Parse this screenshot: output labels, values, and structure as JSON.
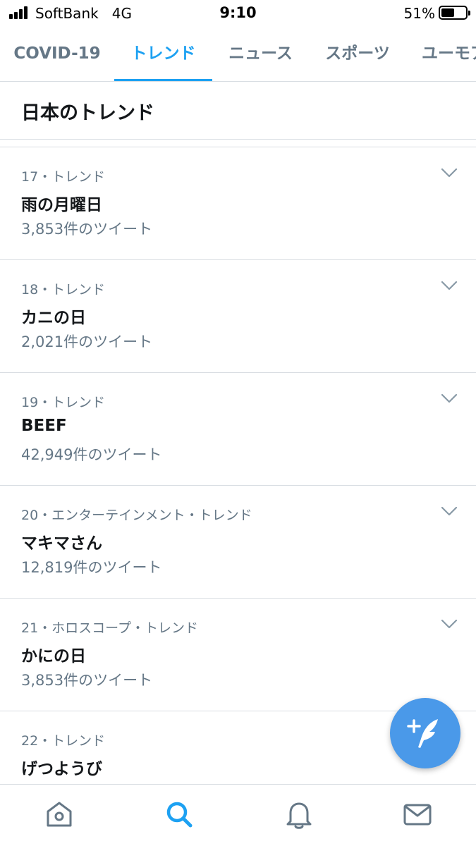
{
  "status_bar": {
    "carrier": "SoftBank",
    "network": "4G",
    "time": "9:10",
    "battery_percent": "51%"
  },
  "tabs": [
    {
      "label": "COVID-19",
      "active": false
    },
    {
      "label": "トレンド",
      "active": true
    },
    {
      "label": "ニュース",
      "active": false
    },
    {
      "label": "スポーツ",
      "active": false
    },
    {
      "label": "ユーモア",
      "active": false
    }
  ],
  "section": {
    "title": "日本のトレンド"
  },
  "trends": [
    {
      "meta": "17・トレンド",
      "name": "雨の月曜日",
      "count": "3,853件のツイート"
    },
    {
      "meta": "18・トレンド",
      "name": "カニの日",
      "count": "2,021件のツイート"
    },
    {
      "meta": "19・トレンド",
      "name": "BEEF",
      "count": "42,949件のツイート"
    },
    {
      "meta": "20・エンターテインメント・トレンド",
      "name": "マキマさん",
      "count": "12,819件のツイート"
    },
    {
      "meta": "21・ホロスコープ・トレンド",
      "name": "かにの日",
      "count": "3,853件のツイート"
    },
    {
      "meta": "22・トレンド",
      "name": "げつようび",
      "count": ""
    }
  ],
  "icons": {
    "fab": "compose-tweet-icon",
    "nav": [
      "home-icon",
      "search-icon",
      "notifications-bell-icon",
      "messages-envelope-icon"
    ]
  },
  "colors": {
    "accent": "#1da1f2",
    "fab": "#4a99e9",
    "secondary_text": "#657786",
    "primary_text": "#14171a",
    "divider": "#d8dde2"
  }
}
